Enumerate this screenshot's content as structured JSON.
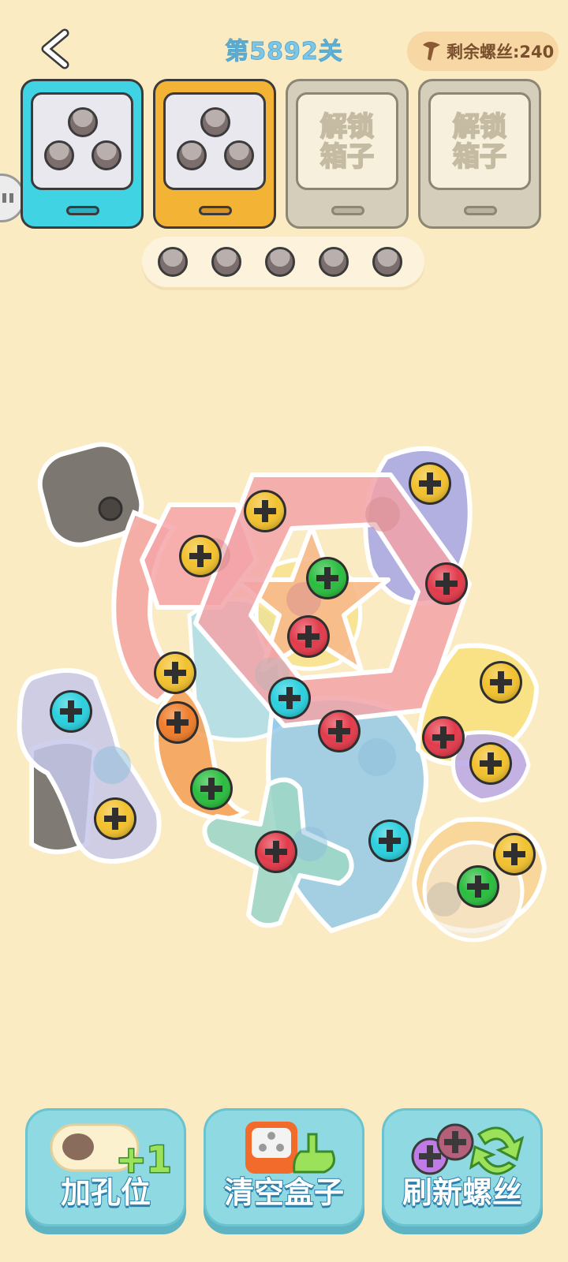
{
  "header": {
    "level_title": "第5892关",
    "screws_remaining": "剩余螺丝:240"
  },
  "boxes": [
    {
      "state": "active",
      "color": "#3fd3e3",
      "holes": 3
    },
    {
      "state": "active",
      "color": "#f3b335",
      "holes": 3
    },
    {
      "state": "locked",
      "label_line1": "解锁",
      "label_line2": "箱子"
    },
    {
      "state": "locked",
      "label_line1": "解锁",
      "label_line2": "箱子"
    }
  ],
  "spare_holes": 5,
  "board": {
    "screw_colors": {
      "yellow": "#f2c12e",
      "red": "#e23b4b",
      "green": "#2bbd3f",
      "cyan": "#2bd0de",
      "orange": "#ee7d2b"
    }
  },
  "tools": [
    {
      "label": "加孔位",
      "badge": "+1"
    },
    {
      "label": "清空盒子"
    },
    {
      "label": "刷新螺丝"
    }
  ],
  "icons": {
    "back": "chevron-left-icon",
    "screw": "screw-icon"
  }
}
